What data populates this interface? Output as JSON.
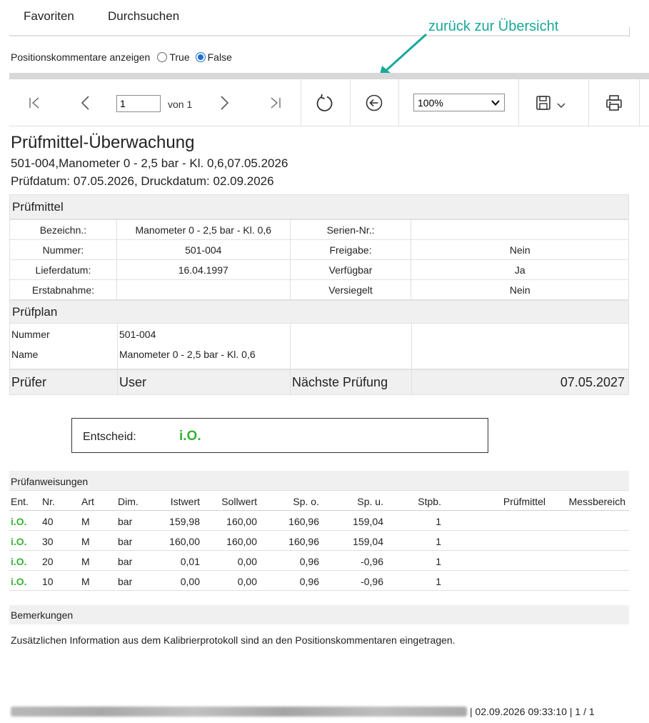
{
  "menu": {
    "favorites": "Favoriten",
    "browse": "Durchsuchen"
  },
  "annotation": "zurück zur Übersicht",
  "options": {
    "label": "Positionskommentare anzeigen",
    "true_label": "True",
    "false_label": "False",
    "selected": "False"
  },
  "toolbar": {
    "page_value": "1",
    "page_of": "von 1",
    "zoom": "100%"
  },
  "report": {
    "title": "Prüfmittel-Überwachung",
    "subtitle1": "501-004,Manometer 0 - 2,5 bar  - Kl. 0,6,07.05.2026",
    "subtitle2": "Prüfdatum: 07.05.2026, Druckdatum: 02.09.2026",
    "pruefmittel": {
      "heading": "Prüfmittel",
      "rows": [
        [
          "Bezeichn.:",
          "Manometer 0 - 2,5 bar  - Kl. 0,6",
          "Serien-Nr.:",
          ""
        ],
        [
          "Nummer:",
          "501-004",
          "Freigabe:",
          "Nein"
        ],
        [
          "Lieferdatum:",
          "16.04.1997",
          "Verfügbar",
          "Ja"
        ],
        [
          "Erstabnahme:",
          "",
          "Versiegelt",
          "Nein"
        ]
      ]
    },
    "pruefplan": {
      "heading": "Prüfplan",
      "nummer_label": "Nummer",
      "nummer_value": "501-004",
      "name_label": "Name",
      "name_value": "Manometer 0 - 2,5 bar  - Kl. 0,6"
    },
    "pruefer": {
      "label": "Prüfer",
      "value": "User",
      "next_label": "Nächste Prüfung",
      "next_value": "07.05.2027"
    },
    "decision": {
      "label": "Entscheid:",
      "value": "i.O."
    },
    "instructions": {
      "heading": "Prüfanweisungen",
      "columns": [
        "Ent.",
        "Nr.",
        "Art",
        "Dim.",
        "Istwert",
        "Sollwert",
        "Sp. o.",
        "Sp. u.",
        "Stpb.",
        "Prüfmittel",
        "Messbereich"
      ],
      "rows": [
        [
          "i.O.",
          "40",
          "M",
          "bar",
          "159,98",
          "160,00",
          "160,96",
          "159,04",
          "1",
          "",
          ""
        ],
        [
          "i.O.",
          "30",
          "M",
          "bar",
          "160,00",
          "160,00",
          "160,96",
          "159,04",
          "1",
          "",
          ""
        ],
        [
          "i.O.",
          "20",
          "M",
          "bar",
          "0,01",
          "0,00",
          "0,96",
          "-0,96",
          "1",
          "",
          ""
        ],
        [
          "i.O.",
          "10",
          "M",
          "bar",
          "0,00",
          "0,00",
          "0,96",
          "-0,96",
          "1",
          "",
          ""
        ]
      ]
    },
    "remarks": {
      "heading": "Bemerkungen",
      "text": "Zusätzlichen Information aus dem Kalibrierprotokoll sind an den Positionskommentaren eingetragen."
    },
    "footer": "| 02.09.2026 09:33:10 | 1 / 1"
  },
  "colors": {
    "ok_green": "#36b336",
    "annotation_teal": "#1aa89a",
    "radio_blue": "#1a6fd6"
  }
}
